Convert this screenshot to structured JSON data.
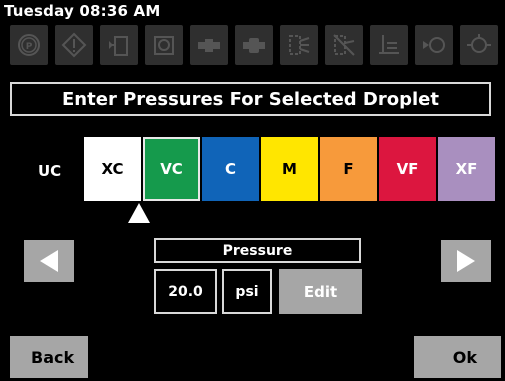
{
  "status": {
    "datetime": "Tuesday 08:36 AM"
  },
  "toolbar": {
    "icons": [
      "parking-brake-icon",
      "warning-alert-icon",
      "tank-level-icon",
      "pump-icon",
      "valve-icon",
      "valve-alt-icon",
      "boom-sections-icon",
      "boom-off-icon",
      "flow-rate-icon",
      "nozzle-icon",
      "nozzle-settings-icon"
    ]
  },
  "screen": {
    "title": "Enter Pressures For Selected Droplet"
  },
  "droplet": {
    "label": "UC",
    "selected": "VC",
    "sizes": [
      {
        "code": "XC",
        "bg": "#ffffff",
        "fg": "#000000"
      },
      {
        "code": "VC",
        "bg": "#159a4c",
        "fg": "#ffffff"
      },
      {
        "code": "C",
        "bg": "#1064b8",
        "fg": "#ffffff"
      },
      {
        "code": "M",
        "bg": "#ffe600",
        "fg": "#000000"
      },
      {
        "code": "F",
        "bg": "#f79a3b",
        "fg": "#000000"
      },
      {
        "code": "VF",
        "bg": "#dc163f",
        "fg": "#ffffff"
      },
      {
        "code": "XF",
        "bg": "#a98fbf",
        "fg": "#ffffff"
      }
    ]
  },
  "pressure": {
    "label": "Pressure",
    "value": "20.0",
    "unit": "psi",
    "edit_label": "Edit"
  },
  "footer": {
    "back_label": "Back",
    "ok_label": "Ok"
  }
}
